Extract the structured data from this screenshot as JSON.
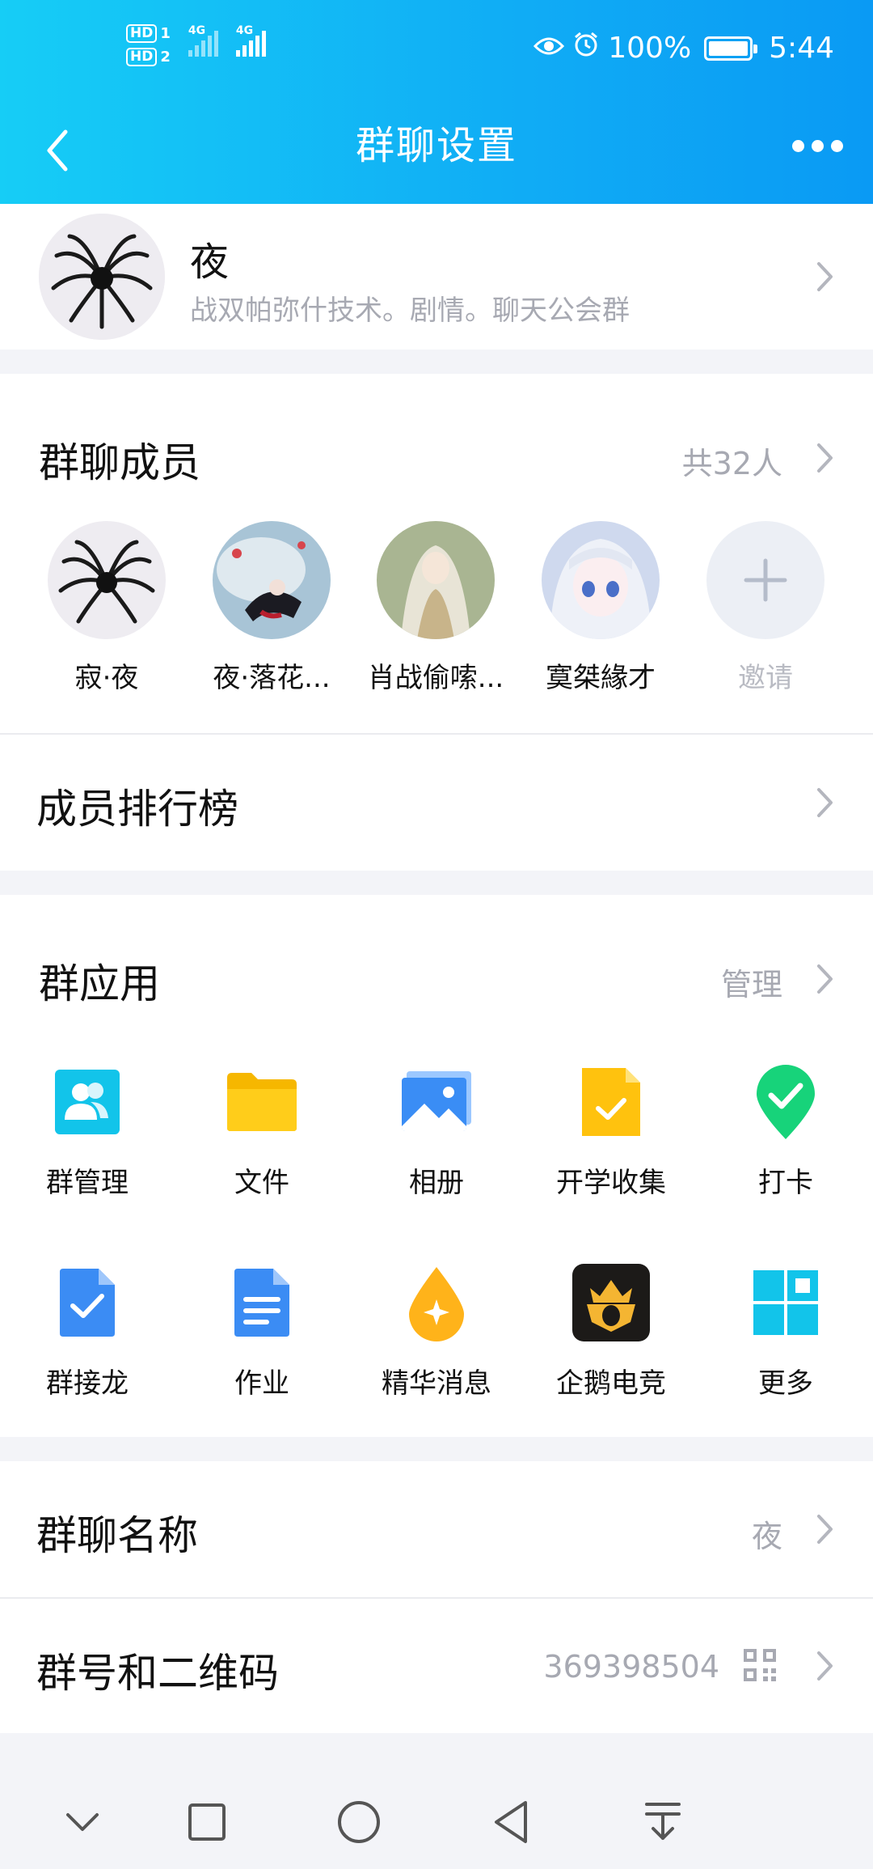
{
  "status_bar": {
    "hd1": "HD",
    "hd1_sub": "1",
    "hd2": "HD",
    "hd2_sub": "2",
    "net1": "4G",
    "net2": "4G",
    "battery": "100%",
    "time": "5:44",
    "battery_level": 1.0,
    "signal1_level": 0.0,
    "signal2_level": 1.0
  },
  "header": {
    "title": "群聊设置",
    "back_icon": "chevron-left-icon",
    "more_icon": "more-dots-icon"
  },
  "group": {
    "name": "夜",
    "description": "战双帕弥什技术。剧情。聊天公会群"
  },
  "members": {
    "title": "群聊成员",
    "count": "共32人",
    "list": [
      {
        "name": "寂·夜"
      },
      {
        "name": "夜·落花..."
      },
      {
        "name": "肖战偷嗦..."
      },
      {
        "name": "寞桀緣才"
      }
    ],
    "invite_label": "邀请"
  },
  "ranking": {
    "label": "成员排行榜"
  },
  "apps": {
    "title": "群应用",
    "manage": "管理",
    "items": [
      {
        "label": "群管理",
        "icon": "group-manage-icon"
      },
      {
        "label": "文件",
        "icon": "folder-icon"
      },
      {
        "label": "相册",
        "icon": "album-icon"
      },
      {
        "label": "开学收集",
        "icon": "collect-doc-icon"
      },
      {
        "label": "打卡",
        "icon": "check-in-icon"
      },
      {
        "label": "群接龙",
        "icon": "relay-icon"
      },
      {
        "label": "作业",
        "icon": "homework-icon"
      },
      {
        "label": "精华消息",
        "icon": "essence-icon"
      },
      {
        "label": "企鹅电竞",
        "icon": "penguin-esports-icon"
      },
      {
        "label": "更多",
        "icon": "more-grid-icon"
      }
    ]
  },
  "group_name_row": {
    "label": "群聊名称",
    "value": "夜"
  },
  "group_id_row": {
    "label": "群号和二维码",
    "value": "369398504"
  },
  "colors": {
    "header_start": "#16cdf6",
    "header_end": "#0a9af4",
    "secondary_text": "#a7a9b2"
  }
}
